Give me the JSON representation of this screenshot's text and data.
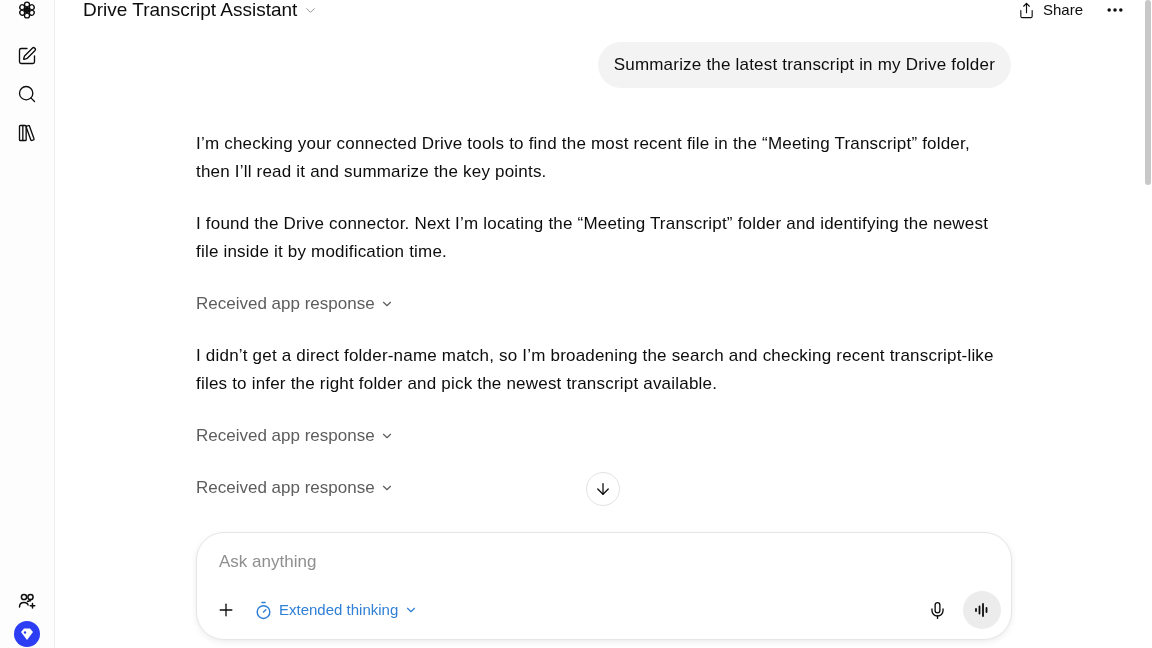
{
  "header": {
    "title": "Drive Transcript Assistant",
    "share_label": "Share"
  },
  "conversation": [
    {
      "kind": "user",
      "text": "Summarize the latest transcript in my Drive folder"
    },
    {
      "kind": "text",
      "text": "I’m checking your connected Drive tools to find the most recent file in the “Meeting Transcript” folder, then I’ll read it and summarize the key points."
    },
    {
      "kind": "text",
      "text": "I found the Drive connector. Next I’m locating the “Meeting Transcript” folder and identifying the newest file inside it by modification time."
    },
    {
      "kind": "tool",
      "label": "Received app response",
      "expanded": false
    },
    {
      "kind": "text",
      "text": "I didn’t get a direct folder-name match, so I’m broadening the search and checking recent transcript-like files to infer the right folder and pick the newest transcript available."
    },
    {
      "kind": "tool",
      "label": "Received app response",
      "expanded": false
    },
    {
      "kind": "tool",
      "label": "Received app response",
      "expanded": false
    }
  ],
  "composer": {
    "placeholder": "Ask anything",
    "mode": {
      "label": "Extended thinking",
      "on": true
    }
  }
}
